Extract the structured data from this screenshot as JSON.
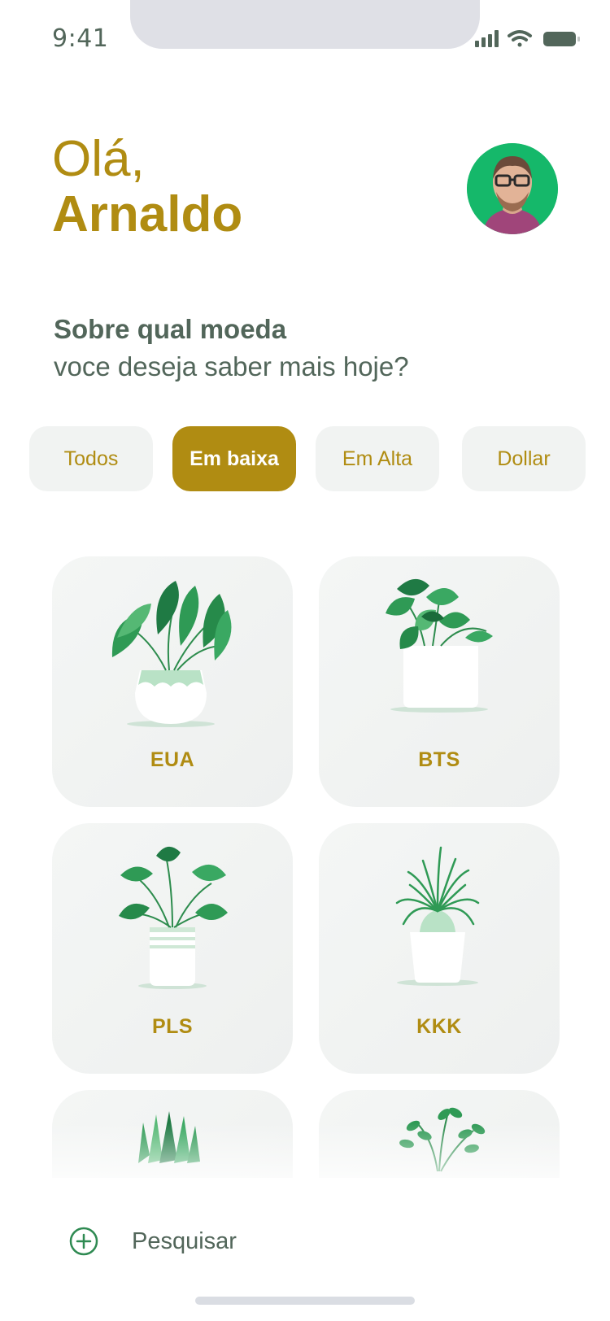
{
  "status_bar": {
    "time": "9:41"
  },
  "greeting": {
    "hello": "Olá,",
    "name": "Arnaldo"
  },
  "question": {
    "line1": "Sobre qual moeda",
    "line2": "voce deseja saber mais hoje?"
  },
  "filters": [
    {
      "label": "Todos",
      "active": false
    },
    {
      "label": "Em baixa",
      "active": true
    },
    {
      "label": "Em Alta",
      "active": false
    },
    {
      "label": "Dollar",
      "active": false
    }
  ],
  "cards": [
    {
      "label": "EUA",
      "icon": "plant-calathea-icon"
    },
    {
      "label": "BTS",
      "icon": "plant-pothos-icon"
    },
    {
      "label": "PLS",
      "icon": "plant-monstera-icon"
    },
    {
      "label": "KKK",
      "icon": "plant-ponytail-palm-icon"
    },
    {
      "label": "",
      "icon": "plant-snake-icon"
    },
    {
      "label": "",
      "icon": "plant-herb-icon"
    }
  ],
  "bottom_bar": {
    "search_label": "Pesquisar",
    "search_icon": "plus-circle-icon"
  },
  "colors": {
    "accent": "#b08c12",
    "text": "#52665a",
    "chip_bg": "#f1f3f2",
    "card_bg": "#f2f4f3",
    "plant_green": "#2f9a55"
  }
}
